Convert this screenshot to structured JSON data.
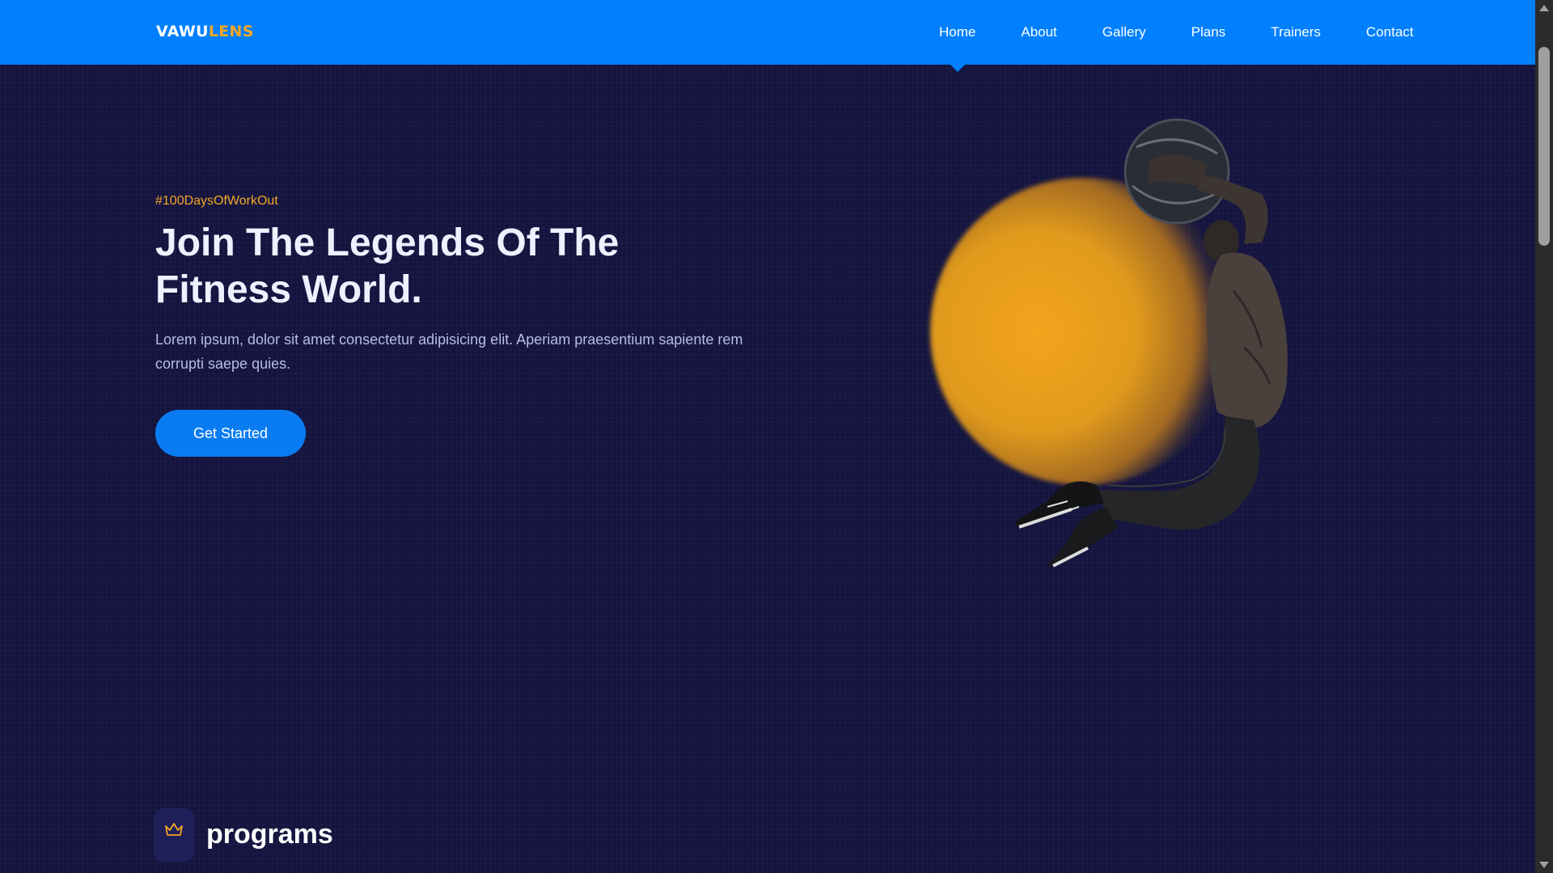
{
  "navbar": {
    "logo_primary": "VAWU",
    "logo_accent": "LENS",
    "links": [
      "Home",
      "About",
      "Gallery",
      "Plans",
      "Trainers",
      "Contact"
    ],
    "active_link": "Home"
  },
  "hero": {
    "hashtag": "#100DaysOfWorkOut",
    "title": "Join The Legends Of The Fitness World.",
    "description": "Lorem ipsum, dolor sit amet consectetur adipisicing elit. Aperiam praesentium sapiente rem corrupti saepe quies.",
    "cta_label": "Get Started"
  },
  "programs": {
    "icon": "crown-icon",
    "title": "programs"
  },
  "colors": {
    "nav_bg": "#0080ff",
    "page_bg": "#14143f",
    "accent": "#f5a623",
    "button": "#0a7cf2"
  }
}
